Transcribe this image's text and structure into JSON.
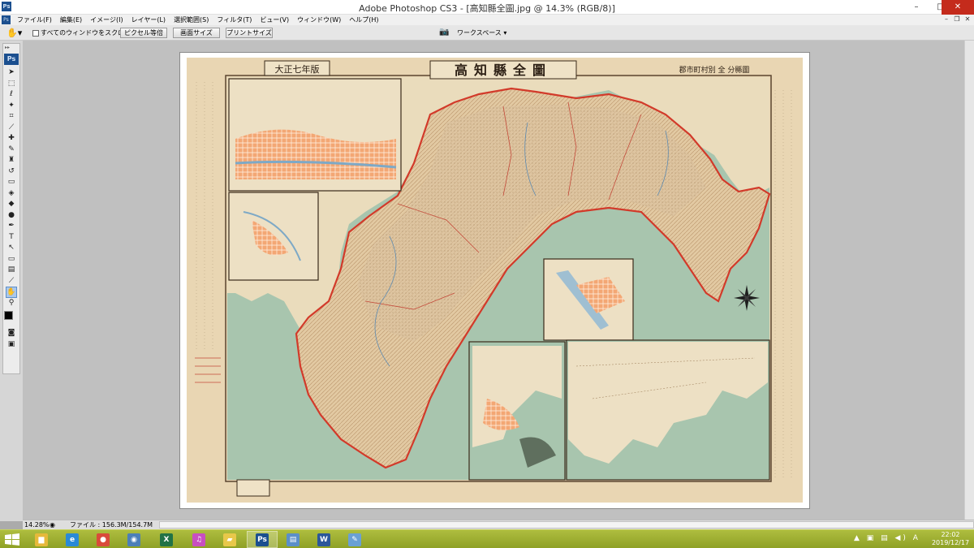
{
  "window": {
    "title": "Adobe Photoshop CS3 - [高知縣全圖.jpg @ 14.3% (RGB/8)]",
    "app_icon": "Ps",
    "controls": [
      "–",
      "□",
      "✕"
    ]
  },
  "menu": {
    "items": [
      "ファイル(F)",
      "編集(E)",
      "イメージ(I)",
      "レイヤー(L)",
      "選択範囲(S)",
      "フィルタ(T)",
      "ビュー(V)",
      "ウィンドウ(W)",
      "ヘルプ(H)"
    ],
    "doc_controls": [
      "–",
      "❐",
      "✕"
    ]
  },
  "options": {
    "tool_icon": "hand-icon",
    "scroll_all_label": "すべてのウィンドウをスクロール",
    "buttons": [
      "ピクセル等倍",
      "画面サイズ",
      "プリントサイズ"
    ],
    "workspace_label": "ワークスペース ▾"
  },
  "tools": {
    "logo": "Ps",
    "items": [
      {
        "icon": "move-icon",
        "glyph": "➤"
      },
      {
        "icon": "marquee-icon",
        "glyph": "⬚"
      },
      {
        "icon": "lasso-icon",
        "glyph": "ℓ"
      },
      {
        "icon": "magic-wand-icon",
        "glyph": "✦"
      },
      {
        "icon": "crop-icon",
        "glyph": "⌗"
      },
      {
        "icon": "slice-icon",
        "glyph": "⟋"
      },
      {
        "icon": "healing-brush-icon",
        "glyph": "✚"
      },
      {
        "icon": "brush-icon",
        "glyph": "✎"
      },
      {
        "icon": "stamp-icon",
        "glyph": "♜"
      },
      {
        "icon": "history-brush-icon",
        "glyph": "↺"
      },
      {
        "icon": "eraser-icon",
        "glyph": "▭"
      },
      {
        "icon": "bucket-icon",
        "glyph": "◈"
      },
      {
        "icon": "blur-icon",
        "glyph": "◆"
      },
      {
        "icon": "dodge-icon",
        "glyph": "●"
      },
      {
        "icon": "pen-icon",
        "glyph": "✒"
      },
      {
        "icon": "type-icon",
        "glyph": "T"
      },
      {
        "icon": "path-select-icon",
        "glyph": "↖"
      },
      {
        "icon": "shape-icon",
        "glyph": "▭"
      },
      {
        "icon": "notes-icon",
        "glyph": "▤"
      },
      {
        "icon": "eyedropper-icon",
        "glyph": "⟋"
      },
      {
        "icon": "hand-icon",
        "glyph": "✋",
        "selected": true
      },
      {
        "icon": "zoom-icon",
        "glyph": "⚲"
      }
    ]
  },
  "map": {
    "title": "高知縣全圖",
    "year_label": "大正七年版",
    "subtitle": "郡市町村別 全 分縣圖"
  },
  "status": {
    "zoom": "14.28%",
    "file_info": "ファイル : 156.3M/154.7M"
  },
  "taskbar": {
    "apps": [
      {
        "icon": "file-explorer-icon",
        "glyph": "▆",
        "color": "#e6b93a"
      },
      {
        "icon": "internet-explorer-icon",
        "glyph": "e",
        "color": "#2a8ad6"
      },
      {
        "icon": "chrome-icon",
        "glyph": "●",
        "color": "#d94b3a"
      },
      {
        "icon": "network-icon",
        "glyph": "◉",
        "color": "#4c7fb8"
      },
      {
        "icon": "excel-icon",
        "glyph": "X",
        "color": "#217346"
      },
      {
        "icon": "itunes-icon",
        "glyph": "♫",
        "color": "#c84fc0"
      },
      {
        "icon": "folder-icon",
        "glyph": "▰",
        "color": "#e8c84a"
      },
      {
        "icon": "photoshop-icon",
        "glyph": "Ps",
        "color": "#1b4f8f",
        "active": true
      },
      {
        "icon": "document-icon",
        "glyph": "▤",
        "color": "#5b8fc9"
      },
      {
        "icon": "word-icon",
        "glyph": "W",
        "color": "#2b579a"
      },
      {
        "icon": "paint-icon",
        "glyph": "✎",
        "color": "#6aa0d4"
      }
    ],
    "tray": "▲ ▣ ▤ ◀) A",
    "time": "22:02",
    "date": "2019/12/17"
  }
}
